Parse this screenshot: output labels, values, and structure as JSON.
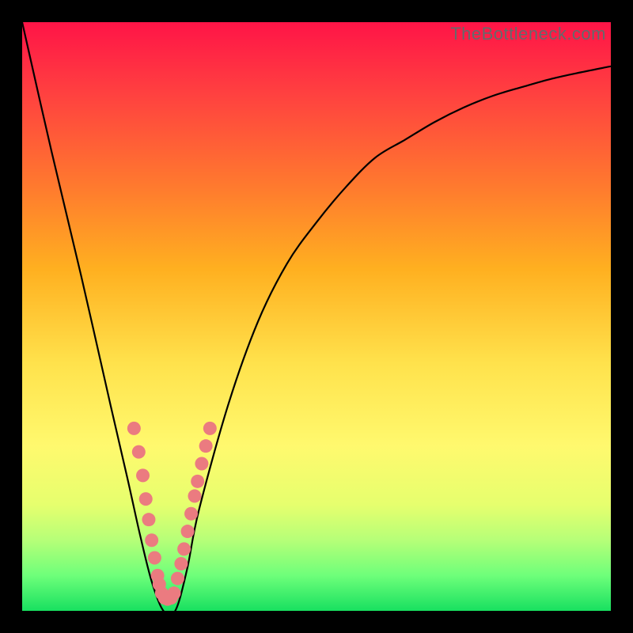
{
  "watermark": "TheBottleneck.com",
  "chart_data": {
    "type": "line",
    "title": "",
    "xlabel": "",
    "ylabel": "",
    "xlim": [
      0,
      100
    ],
    "ylim": [
      0,
      100
    ],
    "series": [
      {
        "name": "curve",
        "x": [
          0,
          5,
          10,
          15,
          18,
          20,
          22,
          24,
          26,
          28,
          30,
          35,
          40,
          45,
          50,
          55,
          60,
          65,
          70,
          75,
          80,
          85,
          90,
          95,
          100
        ],
        "values": [
          100,
          78,
          57,
          35,
          22,
          13,
          5,
          0,
          0,
          7,
          17,
          35,
          49,
          59,
          66,
          72,
          77,
          80,
          83,
          85.5,
          87.5,
          89,
          90.4,
          91.5,
          92.5
        ]
      }
    ],
    "markers": [
      {
        "name": "pink-dots",
        "color": "#eb7b80",
        "points": [
          {
            "x": 19.0,
            "y": 31
          },
          {
            "x": 19.8,
            "y": 27
          },
          {
            "x": 20.5,
            "y": 23
          },
          {
            "x": 21.0,
            "y": 19
          },
          {
            "x": 21.5,
            "y": 15.5
          },
          {
            "x": 22.0,
            "y": 12
          },
          {
            "x": 22.5,
            "y": 9
          },
          {
            "x": 23.0,
            "y": 6
          },
          {
            "x": 23.3,
            "y": 4.5
          },
          {
            "x": 23.7,
            "y": 3
          },
          {
            "x": 24.2,
            "y": 2.2
          },
          {
            "x": 24.7,
            "y": 2
          },
          {
            "x": 25.3,
            "y": 2.2
          },
          {
            "x": 25.8,
            "y": 3
          },
          {
            "x": 26.4,
            "y": 5.5
          },
          {
            "x": 27.0,
            "y": 8
          },
          {
            "x": 27.5,
            "y": 10.5
          },
          {
            "x": 28.1,
            "y": 13.5
          },
          {
            "x": 28.7,
            "y": 16.5
          },
          {
            "x": 29.3,
            "y": 19.5
          },
          {
            "x": 29.8,
            "y": 22
          },
          {
            "x": 30.5,
            "y": 25
          },
          {
            "x": 31.2,
            "y": 28
          },
          {
            "x": 31.9,
            "y": 31
          }
        ]
      }
    ]
  }
}
